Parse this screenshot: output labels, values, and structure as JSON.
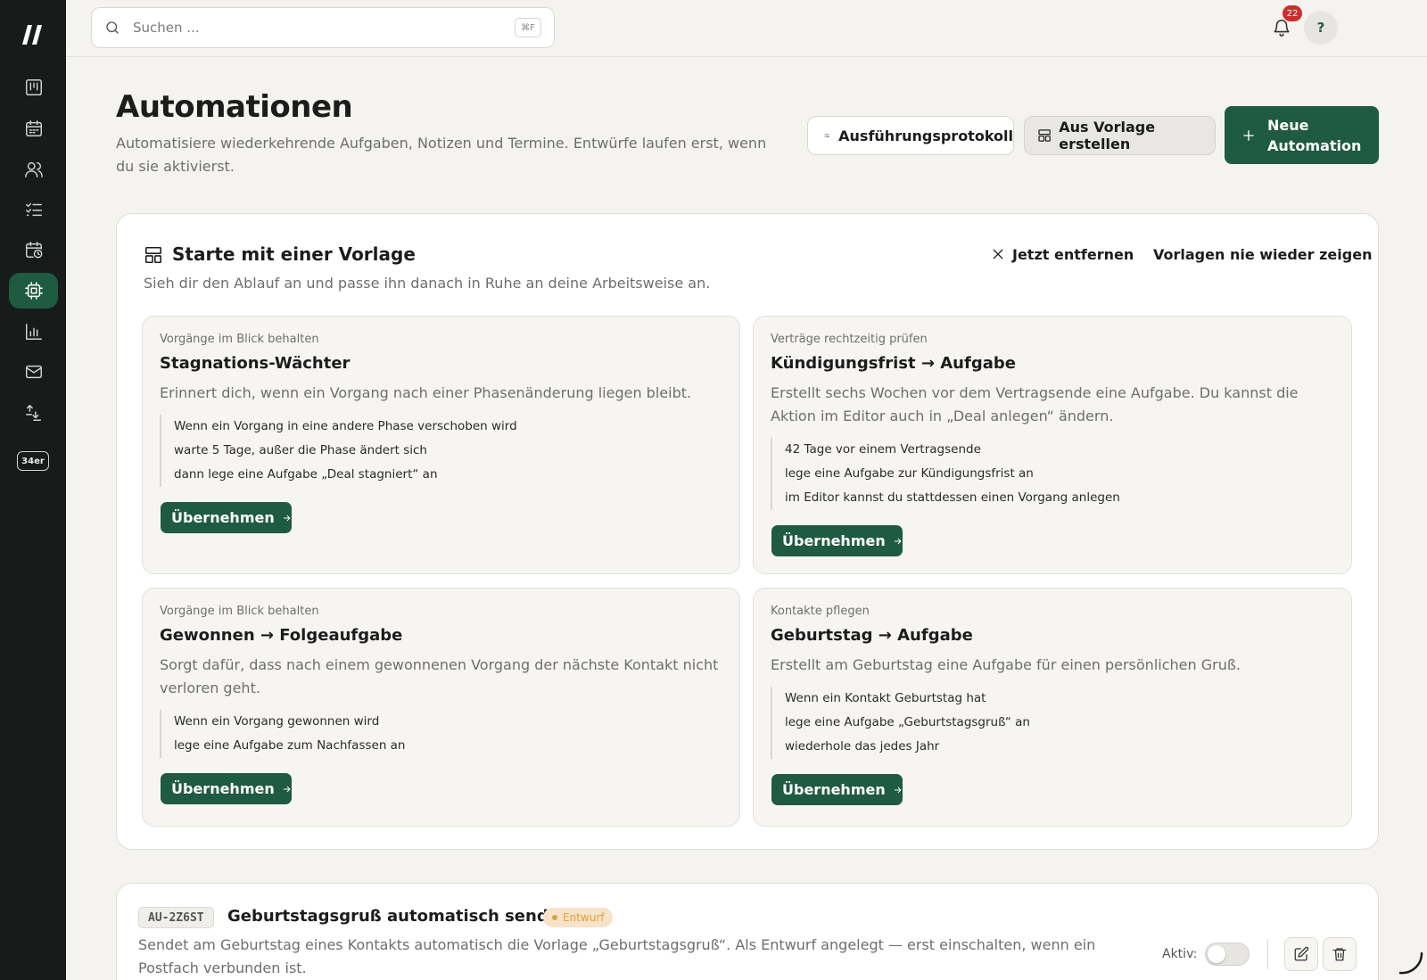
{
  "colors": {
    "accent": "#1f5a43",
    "sidebar": "#171b19",
    "background": "#f4f3f0",
    "badge": "#c9302c",
    "draft": "#e0a13a"
  },
  "sidebar": {
    "items": [
      {
        "icon": "board-icon"
      },
      {
        "icon": "calendar-icon"
      },
      {
        "icon": "users-icon"
      },
      {
        "icon": "tasks-icon"
      },
      {
        "icon": "schedule-icon"
      },
      {
        "icon": "automation-chip-icon",
        "active": true
      },
      {
        "icon": "chart-icon"
      },
      {
        "icon": "mail-icon"
      },
      {
        "icon": "import-export-icon"
      }
    ],
    "badge_label": "34er"
  },
  "topbar": {
    "search_placeholder": "Suchen ...",
    "search_shortcut": "⌘F",
    "notification_count": "22",
    "help_label": "?"
  },
  "header": {
    "title": "Automationen",
    "description": "Automatisiere wiederkehrende Aufgaben, Notizen und Termine. Entwürfe laufen erst, wenn du sie aktivierst.",
    "log_button": "Ausführungsprotokoll",
    "template_button": "Aus Vorlage erstellen",
    "new_button": "Neue Automation"
  },
  "templates": {
    "title": "Starte mit einer Vorlage",
    "subtitle": "Sieh dir den Ablauf an und passe ihn danach in Ruhe an deine Arbeitsweise an.",
    "dismiss_label": "Jetzt entfernen",
    "never_label": "Vorlagen nie wieder zeigen",
    "adopt_label": "Übernehmen",
    "cards": [
      {
        "category": "Vorgänge im Blick behalten",
        "title": "Stagnations-Wächter",
        "description": "Erinnert dich, wenn ein Vorgang nach einer Phasenänderung liegen bleibt.",
        "steps": [
          "Wenn ein Vorgang in eine andere Phase verschoben wird",
          "warte 5 Tage, außer die Phase ändert sich",
          "dann lege eine Aufgabe „Deal stagniert“ an"
        ]
      },
      {
        "category": "Verträge rechtzeitig prüfen",
        "title": "Kündigungsfrist → Aufgabe",
        "description": "Erstellt sechs Wochen vor dem Vertragsende eine Aufgabe. Du kannst die Aktion im Editor auch in „Deal anlegen“ ändern.",
        "steps": [
          "42 Tage vor einem Vertragsende",
          "lege eine Aufgabe zur Kündigungsfrist an",
          "im Editor kannst du stattdessen einen Vorgang anlegen"
        ]
      },
      {
        "category": "Vorgänge im Blick behalten",
        "title": "Gewonnen → Folgeaufgabe",
        "description": "Sorgt dafür, dass nach einem gewonnenen Vorgang der nächste Kontakt nicht verloren geht.",
        "steps": [
          "Wenn ein Vorgang gewonnen wird",
          "lege eine Aufgabe zum Nachfassen an"
        ]
      },
      {
        "category": "Kontakte pflegen",
        "title": "Geburtstag → Aufgabe",
        "description": "Erstellt am Geburtstag eine Aufgabe für einen persönlichen Gruß.",
        "steps": [
          "Wenn ein Kontakt Geburtstag hat",
          "lege eine Aufgabe „Geburtstagsgruß“ an",
          "wiederhole das jedes Jahr"
        ]
      }
    ]
  },
  "automation": {
    "id": "AU-2Z6ST",
    "title": "Geburtstagsgruß automatisch senden",
    "status": "Entwurf",
    "description": "Sendet am Geburtstag eines Kontakts automatisch die Vorlage „Geburtstagsgruß“. Als Entwurf angelegt — erst einschalten, wenn ein Postfach verbunden ist.",
    "active_label": "Aktiv:",
    "active": false
  }
}
